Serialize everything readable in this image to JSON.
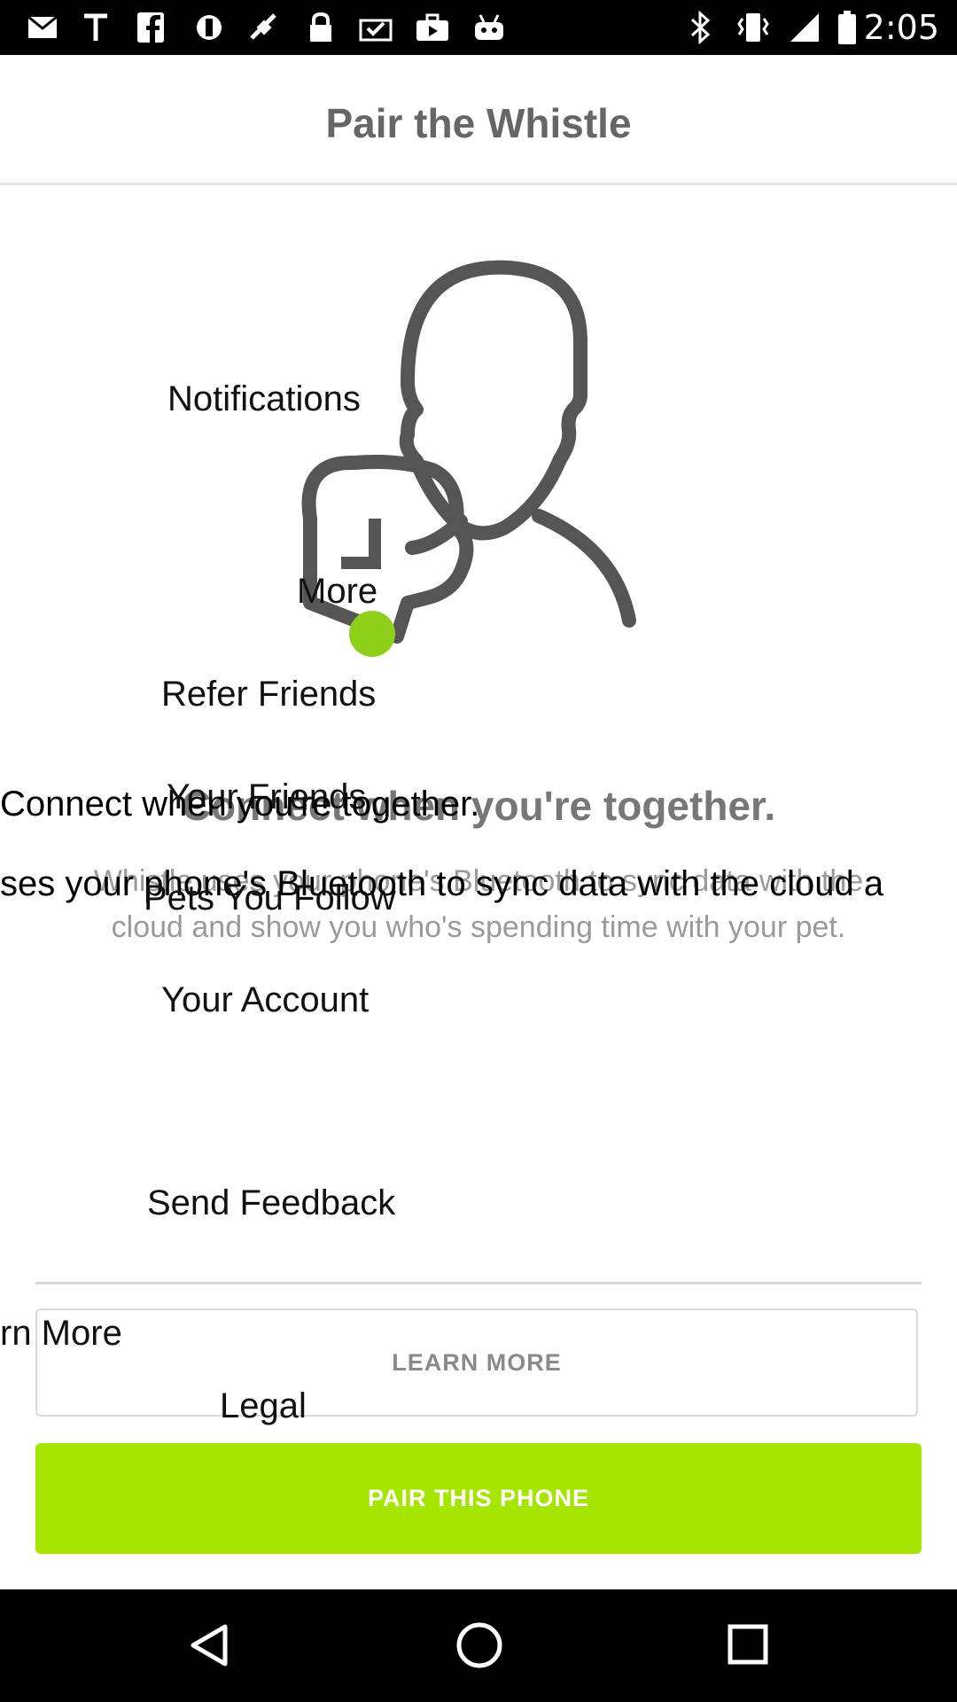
{
  "status_bar": {
    "time": "2:05",
    "left_icons": [
      "mail-icon",
      "text-t-icon",
      "facebook-icon",
      "circle-icon",
      "satellite-icon",
      "lock-icon",
      "clipboard-check-icon",
      "briefcase-icon",
      "robot-icon"
    ],
    "right_icons": [
      "bluetooth-icon",
      "vibrate-icon",
      "signal-icon",
      "battery-icon"
    ]
  },
  "header": {
    "title": "Pair the Whistle"
  },
  "main": {
    "heading": "Connect when you're together.",
    "description": "Whistle uses your phone's Bluetooth to sync data with the cloud and show you who's spending time with your pet."
  },
  "drawer": {
    "items": [
      "Notifications",
      "More",
      "Refer Friends",
      "Your Friends",
      "Pets You Follow",
      "Your Account",
      "Send Feedback",
      "rn More",
      "Legal"
    ]
  },
  "overlay": {
    "heading_fragment": "Connect when you're together.",
    "description_fragment": "ses your phone's Bluetooth to sync data with the cloud a"
  },
  "buttons": {
    "learn_more": "LEARN MORE",
    "pair_phone": "PAIR THIS PHONE"
  },
  "nav": {
    "icons": [
      "back-icon",
      "home-icon",
      "recents-icon"
    ]
  },
  "colors": {
    "accent": "#a6e500",
    "dot": "#8fd11a",
    "icon_stroke": "#555555"
  }
}
